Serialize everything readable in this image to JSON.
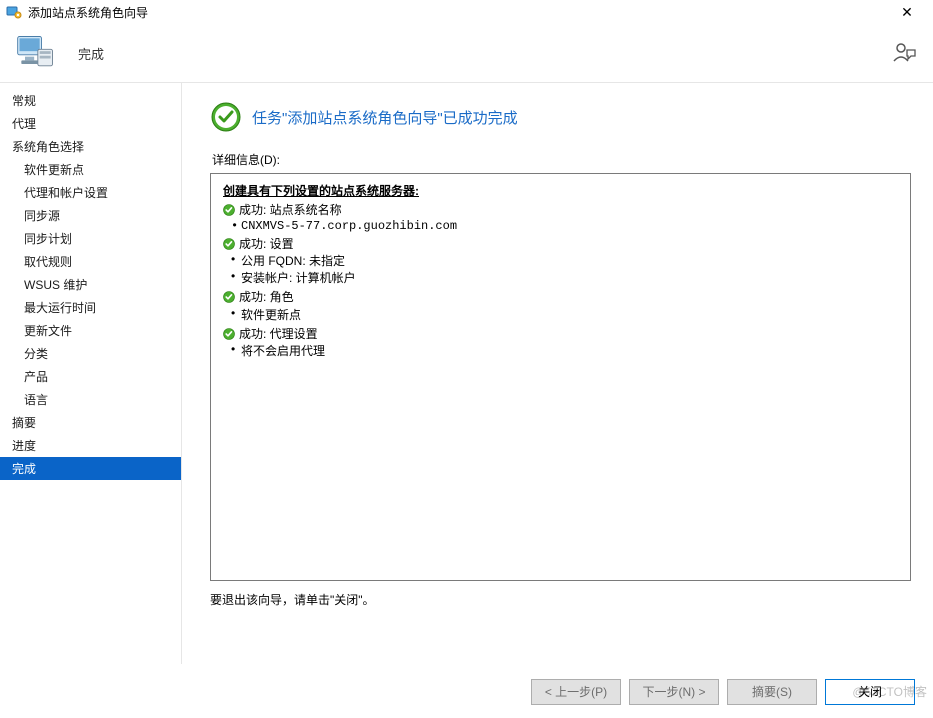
{
  "window": {
    "title": "添加站点系统角色向导"
  },
  "header": {
    "step_title": "完成"
  },
  "sidebar": {
    "items": [
      {
        "label": "常规",
        "indent": false
      },
      {
        "label": "代理",
        "indent": false
      },
      {
        "label": "系统角色选择",
        "indent": false
      },
      {
        "label": "软件更新点",
        "indent": true
      },
      {
        "label": "代理和帐户设置",
        "indent": true
      },
      {
        "label": "同步源",
        "indent": true
      },
      {
        "label": "同步计划",
        "indent": true
      },
      {
        "label": "取代规则",
        "indent": true
      },
      {
        "label": "WSUS 维护",
        "indent": true
      },
      {
        "label": "最大运行时间",
        "indent": true
      },
      {
        "label": "更新文件",
        "indent": true
      },
      {
        "label": "分类",
        "indent": true
      },
      {
        "label": "产品",
        "indent": true
      },
      {
        "label": "语言",
        "indent": true
      },
      {
        "label": "摘要",
        "indent": false
      },
      {
        "label": "进度",
        "indent": false
      },
      {
        "label": "完成",
        "indent": false,
        "selected": true
      }
    ]
  },
  "main": {
    "success_message": "任务\"添加站点系统角色向导\"已成功完成",
    "details_label": "详细信息(D):",
    "heading": "创建具有下列设置的站点系统服务器:",
    "blocks": [
      {
        "title": "成功: 站点系统名称",
        "bullets": [
          {
            "text": "CNXMVS-5-77.corp.guozhibin.com",
            "mono": true
          }
        ]
      },
      {
        "title": "成功: 设置",
        "bullets": [
          {
            "text": "公用 FQDN: 未指定"
          },
          {
            "text": "安装帐户: 计算机帐户"
          }
        ]
      },
      {
        "title": "成功: 角色",
        "bullets": [
          {
            "text": "软件更新点"
          }
        ]
      },
      {
        "title": "成功: 代理设置",
        "bullets": [
          {
            "text": "将不会启用代理"
          }
        ]
      }
    ],
    "exit_text": "要退出该向导，请单击\"关闭\"。"
  },
  "footer": {
    "prev": "< 上一步(P)",
    "next": "下一步(N) >",
    "summary": "摘要(S)",
    "close": "关闭"
  },
  "watermark": "@51CTO博客"
}
